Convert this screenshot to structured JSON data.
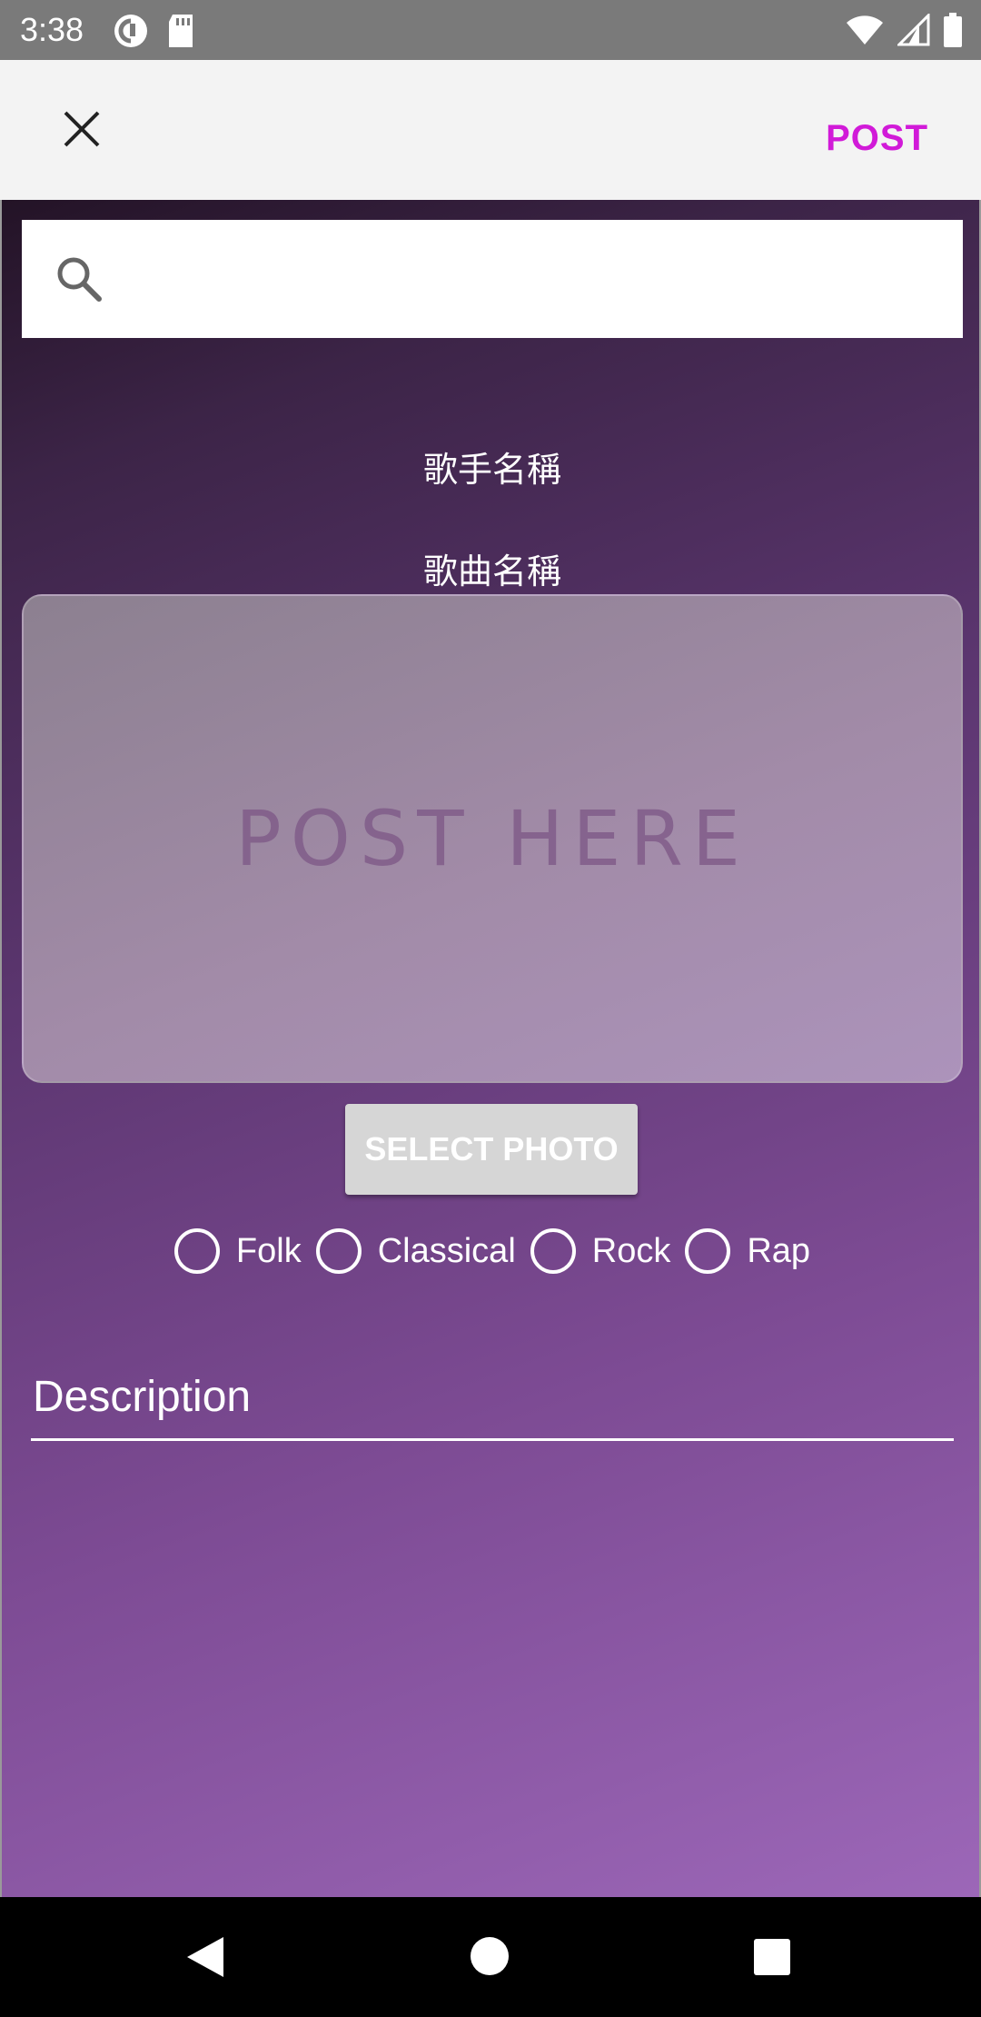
{
  "status_bar": {
    "time": "3:38",
    "left_icons": [
      "pocket-casts-icon",
      "sd-card-icon"
    ],
    "right_icons": [
      "wifi-icon",
      "signal-icon",
      "battery-icon"
    ]
  },
  "app_bar": {
    "close_icon": "close-icon",
    "post_label": "POST",
    "post_color": "#d11ad8"
  },
  "search": {
    "placeholder": "",
    "value": ""
  },
  "song_info": {
    "artist": "歌手名稱",
    "title": "歌曲名稱"
  },
  "post_area": {
    "placeholder_text": "POST HERE"
  },
  "select_photo_label": "SELECT PHOTO",
  "genres": [
    {
      "label": "Folk",
      "selected": false
    },
    {
      "label": "Classical",
      "selected": false
    },
    {
      "label": "Rock",
      "selected": false
    },
    {
      "label": "Rap",
      "selected": false
    }
  ],
  "description": {
    "placeholder": "Description"
  },
  "nav_bar": {
    "icons": [
      "back-icon",
      "home-icon",
      "recents-icon"
    ]
  }
}
